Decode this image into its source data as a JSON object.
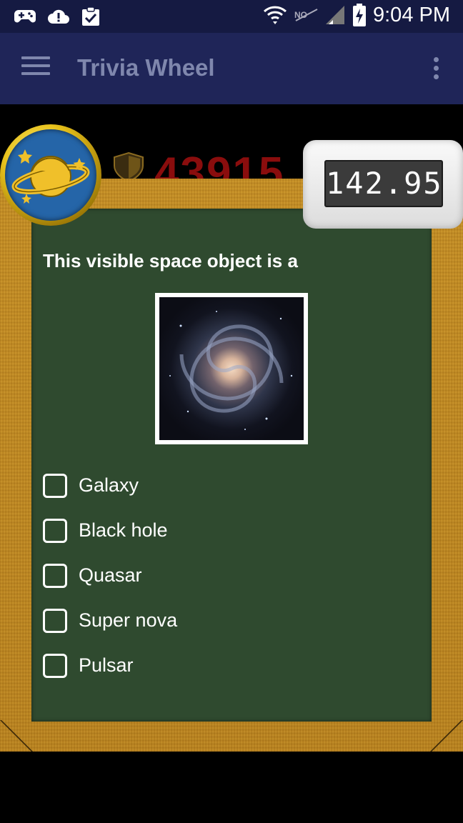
{
  "status_bar": {
    "time": "9:04 PM",
    "left_icons": [
      "gamepad-icon",
      "cloud-alert-icon",
      "clipboard-check-icon"
    ],
    "right_icons": [
      "wifi-icon",
      "no-signal-icon",
      "cell-signal-icon",
      "battery-charging-icon"
    ]
  },
  "app_bar": {
    "title": "Trivia Wheel",
    "menu_icon": "hamburger-menu-icon",
    "overflow_icon": "more-vert-icon"
  },
  "game": {
    "score": "43915",
    "timer": "142.95",
    "category_icon": "planet-icon",
    "question": "This visible space object is a",
    "image_subject": "spiral-galaxy",
    "options": [
      {
        "label": "Galaxy",
        "checked": false
      },
      {
        "label": "Black hole",
        "checked": false
      },
      {
        "label": "Quasar",
        "checked": false
      },
      {
        "label": "Super nova",
        "checked": false
      },
      {
        "label": "Pulsar",
        "checked": false
      }
    ]
  },
  "colors": {
    "status_bar": "#151a42",
    "app_bar": "#1f2558",
    "app_bar_text": "#7f87ad",
    "board": "#2f4a2f",
    "frame": "#c68f22",
    "score": "#8a0d0d"
  }
}
